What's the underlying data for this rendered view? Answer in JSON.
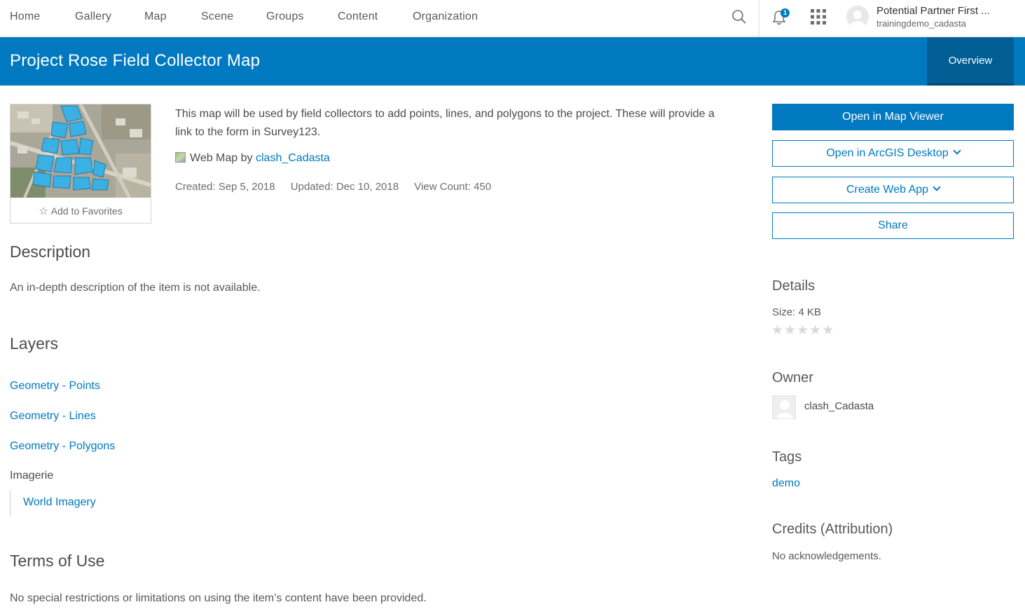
{
  "nav": {
    "items": [
      "Home",
      "Gallery",
      "Map",
      "Scene",
      "Groups",
      "Content",
      "Organization"
    ],
    "notification_count": "1",
    "user_name": "Potential Partner First ...",
    "user_login": "trainingdemo_cadasta"
  },
  "header": {
    "title": "Project Rose Field Collector Map",
    "tab": "Overview"
  },
  "item": {
    "add_favorites": "Add to Favorites",
    "summary": "This map will be used by field collectors to add points, lines, and polygons to the project. These will provide a link to the form in Survey123.",
    "type_prefix": "Web Map by",
    "owner_link": "clash_Cadasta",
    "created": "Created: Sep 5, 2018",
    "updated": "Updated: Dec 10, 2018",
    "views": "View Count: 450"
  },
  "description": {
    "title": "Description",
    "text": "An in-depth description of the item is not available."
  },
  "layers": {
    "title": "Layers",
    "items": [
      "Geometry - Points",
      "Geometry - Lines",
      "Geometry - Polygons"
    ],
    "group_label": "Imagerie",
    "group_items": [
      "World Imagery"
    ]
  },
  "terms": {
    "title": "Terms of Use",
    "text": "No special restrictions or limitations on using the item’s content have been provided."
  },
  "actions": {
    "open_map_viewer": "Open in Map Viewer",
    "open_desktop": "Open in ArcGIS Desktop",
    "create_web_app": "Create Web App",
    "share": "Share"
  },
  "details": {
    "title": "Details",
    "size_label": "Size:",
    "size_value": "4 KB",
    "rating_max": 5,
    "rating_value": 0
  },
  "owner": {
    "title": "Owner",
    "name": "clash_Cadasta"
  },
  "tags": {
    "title": "Tags",
    "items": [
      "demo"
    ]
  },
  "credits": {
    "title": "Credits (Attribution)",
    "text": "No acknowledgements."
  },
  "colors": {
    "brand": "#0079c1",
    "brand_dark": "#005e95",
    "text": "#4c4c4c"
  }
}
